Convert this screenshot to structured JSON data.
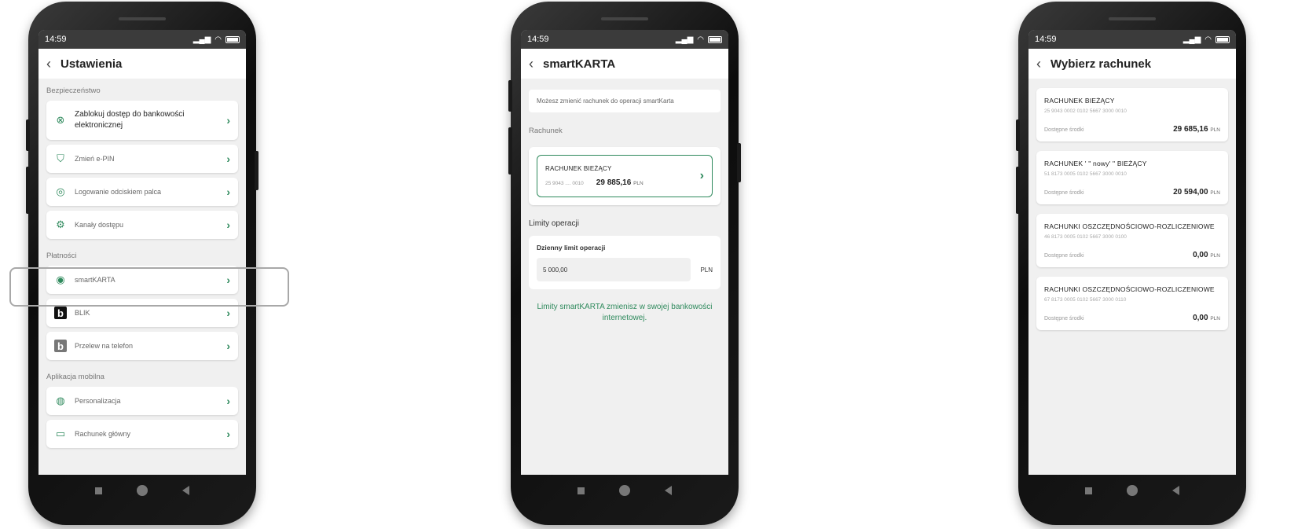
{
  "status": {
    "time": "14:59"
  },
  "screen1": {
    "title": "Ustawienia",
    "sections": [
      {
        "label": "Bezpieczeństwo",
        "items": [
          {
            "label": "Zablokuj dostęp do bankowości elektronicznej",
            "icon": "block-icon"
          },
          {
            "label": "Zmień e-PIN",
            "icon": "shield-check-icon"
          },
          {
            "label": "Logowanie odciskiem palca",
            "icon": "fingerprint-icon"
          },
          {
            "label": "Kanały dostępu",
            "icon": "gear-icon"
          }
        ]
      },
      {
        "label": "Płatności",
        "items": [
          {
            "label": "smartKARTA",
            "icon": "card-icon"
          },
          {
            "label": "BLIK",
            "icon": "blik-icon"
          },
          {
            "label": "Przelew na telefon",
            "icon": "blik-phone-icon"
          }
        ]
      },
      {
        "label": "Aplikacja mobilna",
        "items": [
          {
            "label": "Personalizacja",
            "icon": "person-icon"
          },
          {
            "label": "Rachunek główny",
            "icon": "wallet-icon"
          }
        ]
      }
    ]
  },
  "screen2": {
    "title": "smartKARTA",
    "info": "Możesz zmienić rachunek do operacji smartKarta",
    "account_section": "Rachunek",
    "account": {
      "name": "RACHUNEK BIEŻĄCY",
      "number_short": "25 9043 .... 0010",
      "balance": "29 885,16",
      "currency": "PLN"
    },
    "limits_section": "Limity operacji",
    "limit_label": "Dzienny limit operacji",
    "limit_value": "5 000,00",
    "limit_currency": "PLN",
    "note": "Limity smartKARTA zmienisz w swojej bankowości internetowej."
  },
  "screen3": {
    "title": "Wybierz rachunek",
    "available_label": "Dostępne środki",
    "accounts": [
      {
        "name": "RACHUNEK BIEŻĄCY",
        "number": "25 9043 0002 0102 5667 3000 0010",
        "balance": "29 685,16",
        "currency": "PLN"
      },
      {
        "name": "RACHUNEK ' \" nowy' \" BIEŻĄCY",
        "number": "51 8173 0005 0102 5667 3000 0010",
        "balance": "20 594,00",
        "currency": "PLN"
      },
      {
        "name": "RACHUNKI OSZCZĘDNOŚCIOWO-ROZLICZENIOWE",
        "number": "46 8173 0005 0102 5667 3000 0100",
        "balance": "0,00",
        "currency": "PLN"
      },
      {
        "name": "RACHUNKI OSZCZĘDNOŚCIOWO-ROZLICZENIOWE",
        "number": "67 8173 0005 0102 5667 3000 0110",
        "balance": "0,00",
        "currency": "PLN"
      }
    ]
  }
}
